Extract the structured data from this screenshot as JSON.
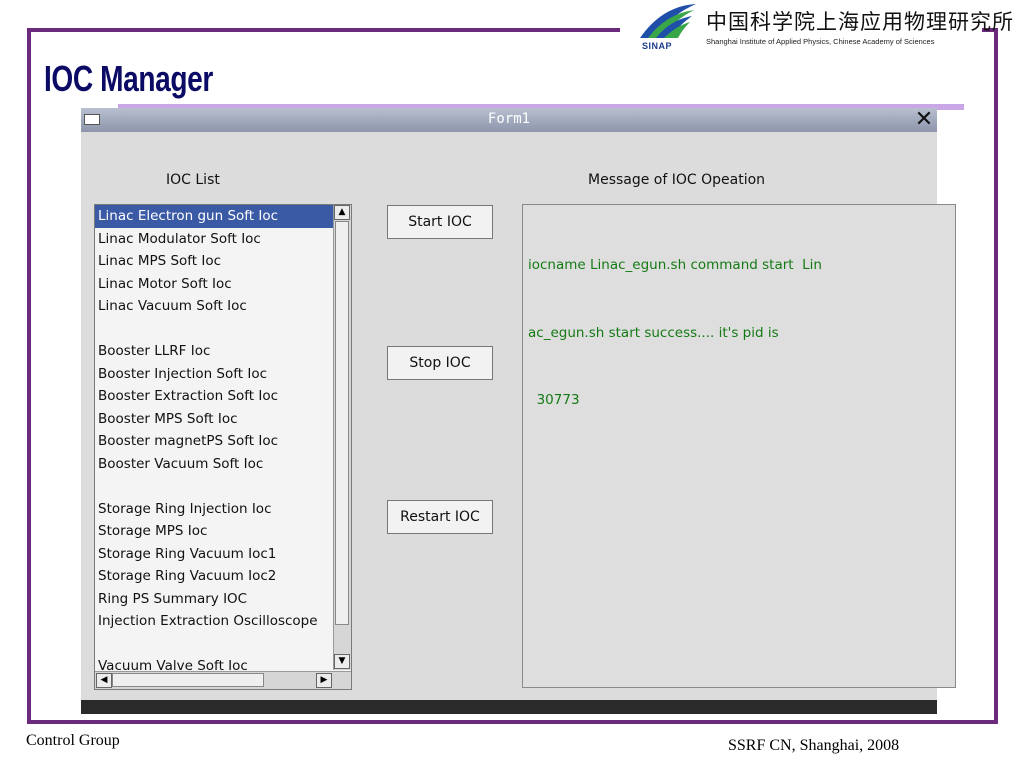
{
  "slide": {
    "title": "IOC Manager",
    "footer_left": "Control Group",
    "footer_right": "SSRF CN, Shanghai, 2008"
  },
  "logo": {
    "abbr": "SINAP",
    "name_cn": "中国科学院上海应用物理研究所",
    "name_en": "Shanghai Institute of Applied Physics, Chinese Academy of Sciences"
  },
  "window": {
    "title": "Form1",
    "ioc_list_label": "IOC List",
    "message_label": "Message of IOC Opeation",
    "ioc_items": [
      "Linac Electron gun Soft Ioc",
      "Linac Modulator Soft Ioc",
      "Linac MPS Soft Ioc",
      "Linac Motor Soft  Ioc",
      "Linac Vacuum Soft Ioc",
      "",
      "Booster LLRF Ioc",
      "Booster Injection Soft  Ioc",
      "Booster Extraction Soft Ioc",
      "Booster MPS Soft Ioc",
      "Booster magnetPS Soft Ioc",
      "Booster Vacuum Soft Ioc",
      "",
      "Storage Ring Injection Ioc",
      "Storage MPS Ioc",
      "Storage Ring Vacuum Ioc1",
      "Storage Ring Vacuum Ioc2",
      "Ring PS Summary IOC",
      "Injection Extraction Oscilloscope",
      "",
      "Vacuum Valve Soft Ioc"
    ],
    "selected_item": "Linac Electron gun Soft Ioc",
    "buttons": {
      "start": "Start IOC",
      "stop": "Stop IOC",
      "restart": "Restart IOC"
    },
    "message_lines": [
      "iocname Linac_egun.sh command start  Lin",
      "ac_egun.sh start success.... it's pid is",
      "  30773"
    ]
  },
  "colors": {
    "frame": "#6b2a7e",
    "title": "#0b0b66",
    "selection": "#3a5aa6",
    "message_text": "#147a14"
  }
}
